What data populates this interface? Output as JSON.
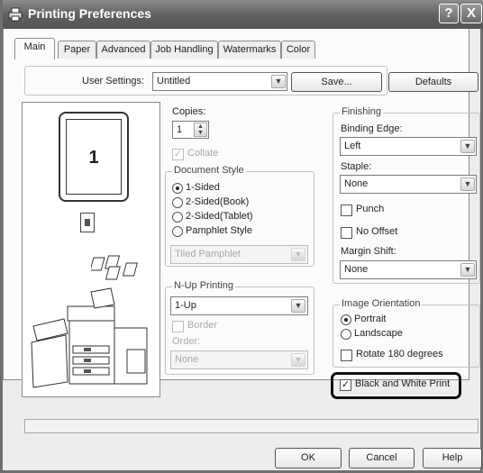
{
  "window": {
    "title": "Printing Preferences",
    "help_glyph": "?",
    "close_glyph": "X"
  },
  "tabs": [
    {
      "label": "Main"
    },
    {
      "label": "Paper"
    },
    {
      "label": "Advanced"
    },
    {
      "label": "Job Handling"
    },
    {
      "label": "Watermarks"
    },
    {
      "label": "Color"
    }
  ],
  "user_settings": {
    "label": "User Settings:",
    "value": "Untitled",
    "save_label": "Save...",
    "defaults_label": "Defaults"
  },
  "preview": {
    "page_number": "1"
  },
  "copies": {
    "label": "Copies:",
    "value": "1"
  },
  "collate": {
    "label": "Collate",
    "checked": true,
    "enabled": false
  },
  "document_style": {
    "legend": "Document Style",
    "options": [
      "1-Sided",
      "2-Sided(Book)",
      "2-Sided(Tablet)",
      "Pamphlet Style"
    ],
    "selected": "1-Sided",
    "pamphlet_value": "Tiled Pamphlet"
  },
  "nup": {
    "legend": "N-Up Printing",
    "value": "1-Up",
    "border_label": "Border",
    "order_label": "Order:",
    "order_value": "None"
  },
  "finishing": {
    "legend": "Finishing",
    "binding_label": "Binding Edge:",
    "binding_value": "Left",
    "staple_label": "Staple:",
    "staple_value": "None",
    "punch_label": "Punch",
    "no_offset_label": "No Offset",
    "margin_label": "Margin Shift:",
    "margin_value": "None"
  },
  "orientation": {
    "legend": "Image Orientation",
    "portrait_label": "Portrait",
    "landscape_label": "Landscape",
    "selected": "Portrait",
    "rotate_label": "Rotate 180 degrees"
  },
  "bw_print": {
    "label": "Black and White Print",
    "checked": true,
    "highlight_color": "#111111"
  },
  "footer": {
    "ok_label": "OK",
    "cancel_label": "Cancel",
    "help_label": "Help"
  },
  "colors": {
    "title_bar": "#5f5f5f",
    "panel": "#fbfbfb",
    "window": "#ededed"
  }
}
